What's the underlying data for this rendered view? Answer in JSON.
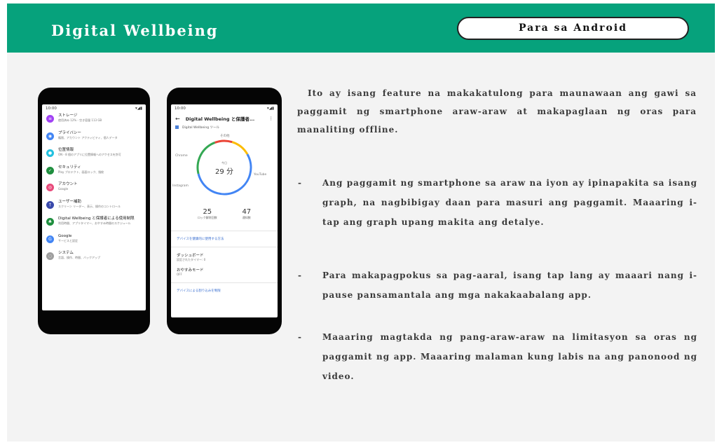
{
  "header": {
    "title": "Digital Wellbeing",
    "badge": "Para sa Android"
  },
  "colors": {
    "header_bg": "#06a27c",
    "slide_bg": "#f3f3f3",
    "text": "#3a3a3a"
  },
  "phone1": {
    "time": "10:00",
    "signal": "▾◢▮",
    "items": [
      {
        "title": "ストレージ",
        "sub": "使用済み 12% - 空き容量 113 GB",
        "color": "#a142f4",
        "icon": "storage-icon",
        "glyph": "≡"
      },
      {
        "title": "プライバシー",
        "sub": "権限、アカウント アクティビティ、個人データ",
        "color": "#4285f4",
        "icon": "privacy-icon",
        "glyph": "◉"
      },
      {
        "title": "位置情報",
        "sub": "ON - 8 個のアプリに位置情報へのアクセスを許可",
        "color": "#24c1e0",
        "icon": "location-icon",
        "glyph": "●"
      },
      {
        "title": "セキュリティ",
        "sub": "Play プロテクト、画面ロック、指紋",
        "color": "#1e8e3e",
        "icon": "security-icon",
        "glyph": "✓"
      },
      {
        "title": "アカウント",
        "sub": "Google",
        "color": "#e8497a",
        "icon": "account-icon",
        "glyph": "◎"
      },
      {
        "title": "ユーザー補助",
        "sub": "スクリーン リーダー、表示、操作のコントロール",
        "color": "#3949ab",
        "icon": "accessibility-icon",
        "glyph": "†"
      },
      {
        "title": "Digital Wellbeing と保護者による使用制限",
        "sub": "利用時間、アプリタイマー、おやすみ時間のスケジュール",
        "color": "#1e8e3e",
        "icon": "wellbeing-icon",
        "glyph": "♣"
      },
      {
        "title": "Google",
        "sub": "サービスと設定",
        "color": "#4285f4",
        "icon": "google-icon",
        "glyph": "G"
      },
      {
        "title": "システム",
        "sub": "言語、操作、時間、バックアップ",
        "color": "#9e9e9e",
        "icon": "system-icon",
        "glyph": "◌"
      }
    ]
  },
  "phone2": {
    "time": "10:00",
    "signal": "▾◢▮",
    "title": "Digital Wellbeing と保護者...",
    "subtitle": "Digital Wellbeing ツール",
    "ring_labels": {
      "top": "その他",
      "left": "Chrome",
      "right": "YouTube",
      "bottom_left": "Instagram"
    },
    "center_small": "今日",
    "center_value": "29 分",
    "stat1_value": "25",
    "stat1_label": "ロック解除回数",
    "stat2_value": "47",
    "stat2_label": "通知数",
    "link1": "デバイスを健康的に使用する方法",
    "item1_title": "ダッシュボード",
    "item1_sub": "設定されたタイマー: 0",
    "item2_title": "おやすみモード",
    "item2_sub": "OFF",
    "link2": "デバイスによる割り込みを制限"
  },
  "body": {
    "intro": "Ito ay isang feature na makakatulong para maunawaan ang gawi sa paggamit ng smartphone araw-araw at makapaglaan ng oras para manaliting offline.",
    "bullets": [
      {
        "dash": "-",
        "text": "Ang paggamit ng smartphone sa araw na iyon ay ipinapakita sa isang graph, na nagbibigay daan para masuri ang paggamit. Maaaring i-tap ang graph upang makita ang detalye."
      },
      {
        "dash": "-",
        "text": "Para makapagpokus sa pag-aaral, isang tap lang ay maaari nang i-pause pansamantala ang mga nakakaabalang app."
      },
      {
        "dash": "-",
        "text": "Maaaring magtakda ng pang-araw-araw na limitasyon sa oras ng paggamit ng app. Maaaring malaman kung labis na ang panonood ng video."
      }
    ]
  }
}
